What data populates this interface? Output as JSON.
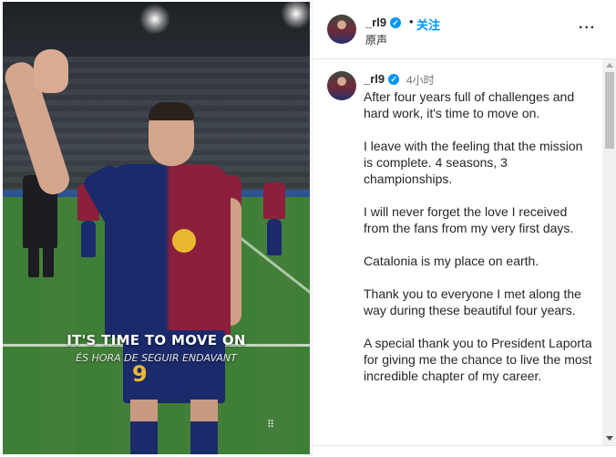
{
  "media": {
    "caption_main": "IT'S TIME TO MOVE ON",
    "caption_sub": "ÉS HORA DE SEGUIR ENDAVANT",
    "shirt_number": "9",
    "options_glyph": "⠿"
  },
  "header": {
    "username": "_rl9",
    "verified_glyph": "✓",
    "separator": "•",
    "follow_label": "关注",
    "audio_label": "原声",
    "more_glyph": "···"
  },
  "comment": {
    "username": "_rl9",
    "verified_glyph": "✓",
    "timestamp": "4小时",
    "paragraphs": [
      "After four years full of challenges and hard work, it's time to move on.",
      "I leave with the feeling that the mission is complete. 4 seasons, 3 championships.",
      "I will never forget the love I received from the fans from my very first days.",
      "Catalonia is my place on earth.",
      "Thank you to everyone I met along the way during these beautiful four years.",
      "A special thank you to President Laporta for giving me the chance to live the most incredible chapter of my career."
    ]
  },
  "colors": {
    "accent": "#0095f6",
    "text": "#262626",
    "muted": "#737373"
  },
  "icons": [
    "verified-badge-icon",
    "more-options-icon",
    "scroll-up-arrow-icon",
    "scroll-down-arrow-icon"
  ]
}
